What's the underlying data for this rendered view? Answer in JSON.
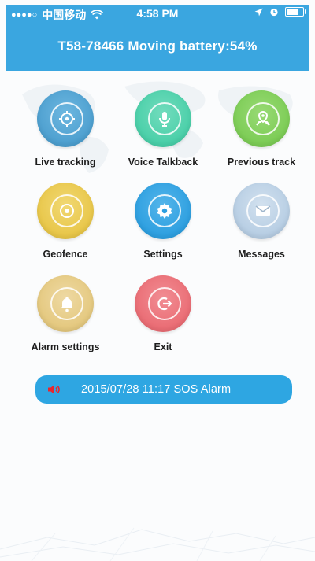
{
  "status_bar": {
    "carrier": "中国移动",
    "time": "4:58 PM"
  },
  "header": {
    "title": "T58-78466 Moving battery:54%"
  },
  "menu": {
    "live_tracking": "Live tracking",
    "voice_talkback": "Voice Talkback",
    "previous_track": "Previous track",
    "geofence": "Geofence",
    "settings": "Settings",
    "messages": "Messages",
    "alarm_settings": "Alarm settings",
    "exit": "Exit"
  },
  "alarm_banner": {
    "text": "2015/07/28 11:17 SOS Alarm"
  },
  "colors": {
    "header": "#3aa6e0",
    "live_tracking": "#4d9fcf",
    "voice_talkback": "#49cfa8",
    "previous_track": "#7ccc55",
    "geofence": "#e8c648",
    "settings": "#2d9fe0",
    "messages": "#b6cde3",
    "alarm_settings": "#e4c87e",
    "exit": "#ea6c74"
  }
}
